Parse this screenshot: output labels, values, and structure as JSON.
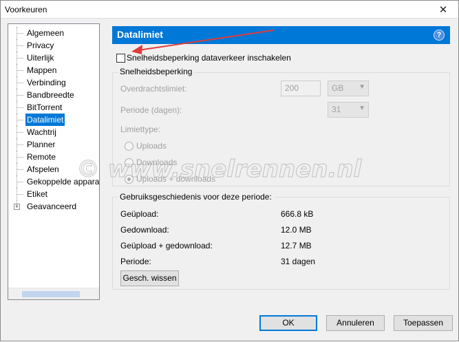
{
  "window": {
    "title": "Voorkeuren",
    "close_glyph": "✕"
  },
  "sidebar": {
    "items": [
      {
        "label": "Algemeen",
        "name": "sidebar-item-algemeen"
      },
      {
        "label": "Privacy",
        "name": "sidebar-item-privacy"
      },
      {
        "label": "Uiterlijk",
        "name": "sidebar-item-uiterlijk"
      },
      {
        "label": "Mappen",
        "name": "sidebar-item-mappen"
      },
      {
        "label": "Verbinding",
        "name": "sidebar-item-verbinding"
      },
      {
        "label": "Bandbreedte",
        "name": "sidebar-item-bandbreedte"
      },
      {
        "label": "BitTorrent",
        "name": "sidebar-item-bittorrent"
      },
      {
        "label": "Datalimiet",
        "name": "sidebar-item-datalimiet",
        "selected": true
      },
      {
        "label": "Wachtrij",
        "name": "sidebar-item-wachtrij"
      },
      {
        "label": "Planner",
        "name": "sidebar-item-planner"
      },
      {
        "label": "Remote",
        "name": "sidebar-item-remote"
      },
      {
        "label": "Afspelen",
        "name": "sidebar-item-afspelen"
      },
      {
        "label": "Gekoppelde apparat",
        "name": "sidebar-item-gekoppelde-apparaten"
      },
      {
        "label": "Etiket",
        "name": "sidebar-item-etiket"
      },
      {
        "label": "Geavanceerd",
        "name": "sidebar-item-geavanceerd",
        "expander": "+"
      }
    ]
  },
  "panel": {
    "title": "Datalimiet",
    "help_glyph": "?",
    "enable_checkbox": {
      "label": "Snelheidsbeperking dataverkeer inschakelen",
      "checked": false
    },
    "speed_limit": {
      "legend": "Snelheidsbeperking",
      "transfer_limit_label": "Overdrachtslimiet:",
      "transfer_limit_value": "200",
      "transfer_unit": "GB",
      "period_label": "Periode (dagen):",
      "period_value": "31",
      "limit_type_label": "Limiettype:",
      "limit_types": [
        {
          "label": "Uploads",
          "checked": false
        },
        {
          "label": "Downloads",
          "checked": false
        },
        {
          "label": "Uploads + downloads",
          "checked": true
        }
      ]
    },
    "usage": {
      "legend": "Gebruiksgeschiedenis voor deze periode:",
      "rows": [
        {
          "label": "Geüpload:",
          "value": "666.8 kB"
        },
        {
          "label": "Gedownload:",
          "value": "12.0 MB"
        },
        {
          "label": "Geüpload + gedownload:",
          "value": "12.7 MB"
        },
        {
          "label": "Periode:",
          "value": "31 dagen"
        }
      ],
      "clear_button": "Gesch. wissen"
    }
  },
  "footer": {
    "ok": "OK",
    "cancel": "Annuleren",
    "apply": "Toepassen"
  },
  "watermark": {
    "text": "© www.snelrennen.nl"
  },
  "colors": {
    "accent": "#0078d7",
    "arrow": "#e23a3a"
  },
  "arrow_glyph": "▾"
}
